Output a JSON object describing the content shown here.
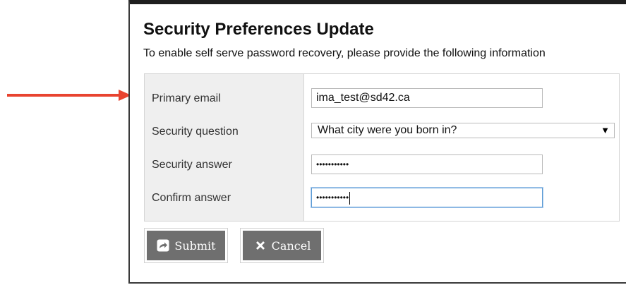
{
  "dialog": {
    "title": "Security Preferences Update",
    "subtitle": "To enable self serve password recovery, please provide the following information"
  },
  "form": {
    "primary_email": {
      "label": "Primary email",
      "value": "ima_test@sd42.ca"
    },
    "security_question": {
      "label": "Security question",
      "selected": "What city were you born in?"
    },
    "security_answer": {
      "label": "Security answer",
      "masked_value": "•••••••••••"
    },
    "confirm_answer": {
      "label": "Confirm answer",
      "masked_value": "•••••••••••"
    }
  },
  "buttons": {
    "submit_label": "Submit",
    "cancel_label": "Cancel"
  },
  "colors": {
    "annotation_arrow": "#e8432f",
    "button_bg": "#6f6f6f",
    "label_column_bg": "#efefef",
    "focus_border": "#5b9bd5"
  },
  "icons": {
    "submit": "share-arrow-icon",
    "cancel": "x-icon",
    "select": "triangle-down-icon",
    "annotation": "red-arrow-icon"
  }
}
